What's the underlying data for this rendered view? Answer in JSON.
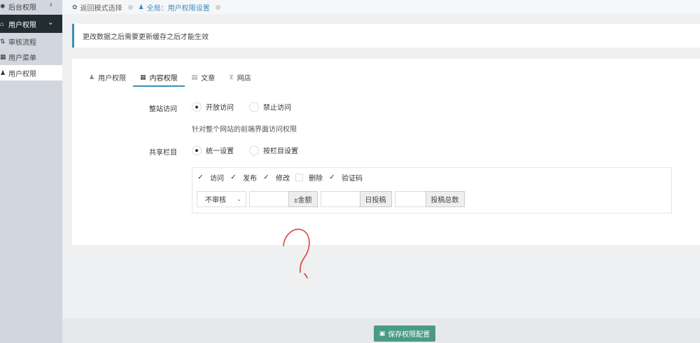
{
  "sidebar": {
    "top": {
      "label": "后台权限",
      "icon": "gear-icon"
    },
    "active": {
      "label": "用户权限",
      "icon": "home-icon"
    },
    "items": [
      {
        "label": "审核流程",
        "icon": "sort-icon"
      },
      {
        "label": "用户菜单",
        "icon": "table-icon"
      },
      {
        "label": "用户权限",
        "icon": "user-icon"
      }
    ]
  },
  "breadcrumb": {
    "back": "返回模式选择",
    "current": "全局：用户权限设置"
  },
  "notice": "更改数据之后需要更新缓存之后才能生效",
  "tabs": [
    {
      "label": "用户权限",
      "icon": "user-icon"
    },
    {
      "label": "内容权限",
      "icon": "table-icon"
    },
    {
      "label": "文章",
      "icon": "article-icon"
    },
    {
      "label": "网店",
      "icon": "cart-icon"
    }
  ],
  "active_tab": "内容权限",
  "site_access": {
    "label": "整站访问",
    "options": [
      "开放访问",
      "禁止访问"
    ],
    "selected": "开放访问",
    "hint": "针对整个网站的前端界面访问权限"
  },
  "shared_column": {
    "label": "共享栏目",
    "options": [
      "统一设置",
      "按栏目设置"
    ],
    "selected": "统一设置"
  },
  "permissions": [
    {
      "label": "访问",
      "checked": true
    },
    {
      "label": "发布",
      "checked": true
    },
    {
      "label": "修改",
      "checked": true
    },
    {
      "label": "删除",
      "checked": false
    },
    {
      "label": "验证码",
      "checked": true
    }
  ],
  "review_select": "不审核",
  "amount_addon": "±金额",
  "daily_addon": "日投稿",
  "total_addon": "投稿总数",
  "save_button": "保存权限配置",
  "colors": {
    "accent": "#3c8dbc",
    "save": "#4a9a85",
    "sidebar_active": "#222d32",
    "scribble": "#d9443a"
  }
}
